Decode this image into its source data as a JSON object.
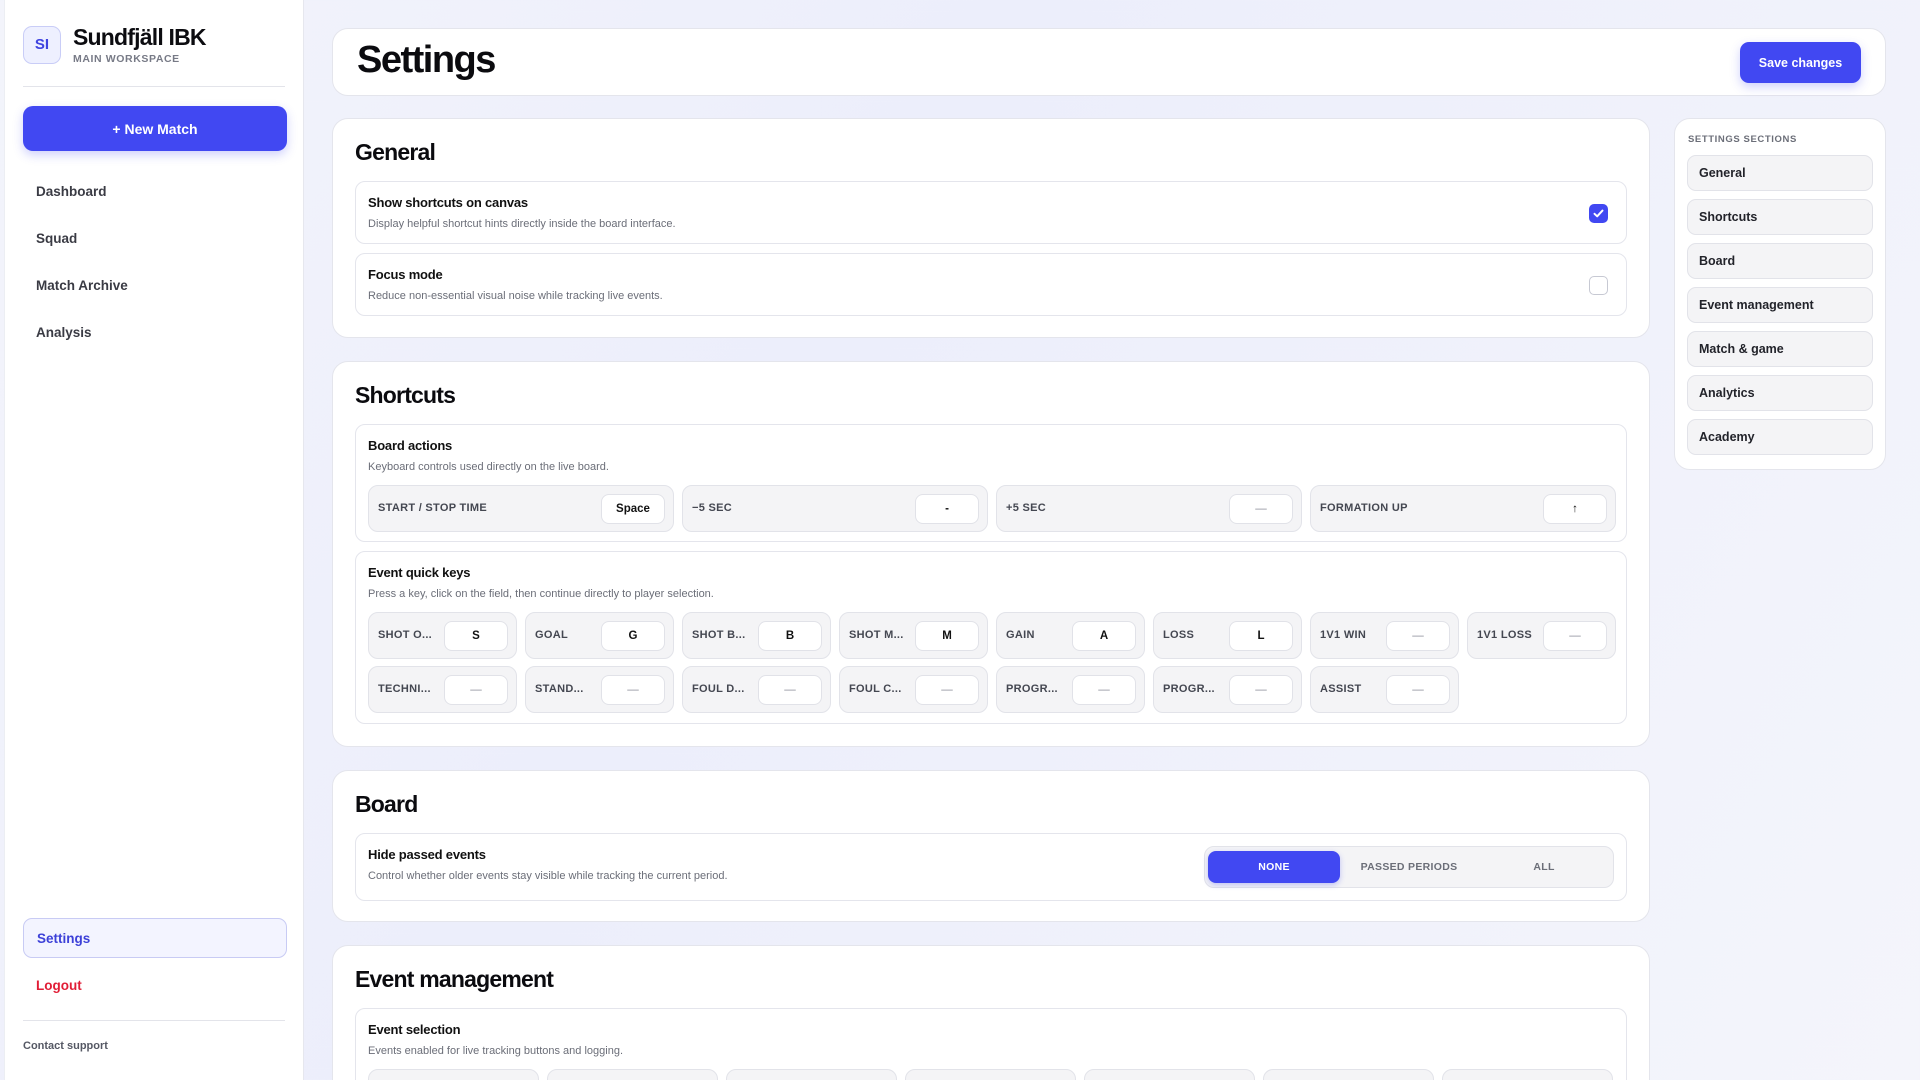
{
  "sidebar": {
    "badge": "SI",
    "club_name": "Sundfjäll IBK",
    "workspace": "MAIN WORKSPACE",
    "new_match": "+ New Match",
    "nav": [
      "Dashboard",
      "Squad",
      "Match Archive",
      "Analysis"
    ],
    "settings": "Settings",
    "logout": "Logout",
    "contact": "Contact support"
  },
  "header": {
    "title": "Settings",
    "save": "Save changes"
  },
  "general": {
    "title": "General",
    "items": [
      {
        "title": "Show shortcuts on canvas",
        "desc": "Display helpful shortcut hints directly inside the board interface.",
        "checked": true
      },
      {
        "title": "Focus mode",
        "desc": "Reduce non-essential visual noise while tracking live events.",
        "checked": false
      }
    ]
  },
  "shortcuts": {
    "title": "Shortcuts",
    "board_actions": {
      "title": "Board actions",
      "desc": "Keyboard controls used directly on the live board.",
      "keys": [
        {
          "label": "START / STOP TIME",
          "key": "Space"
        },
        {
          "label": "−5 SEC",
          "key": "-"
        },
        {
          "label": "+5 SEC",
          "key": "—"
        },
        {
          "label": "FORMATION UP",
          "key": "↑"
        }
      ]
    },
    "event_keys": {
      "title": "Event quick keys",
      "desc": "Press a key, click on the field, then continue directly to player selection.",
      "row1": [
        {
          "label": "SHOT O...",
          "key": "S"
        },
        {
          "label": "GOAL",
          "key": "G"
        },
        {
          "label": "SHOT B...",
          "key": "B"
        },
        {
          "label": "SHOT M...",
          "key": "M"
        },
        {
          "label": "GAIN",
          "key": "A"
        },
        {
          "label": "LOSS",
          "key": "L"
        },
        {
          "label": "1V1 WIN",
          "key": "—"
        },
        {
          "label": "1V1 LOSS",
          "key": "—"
        }
      ],
      "row2": [
        {
          "label": "TECHNI...",
          "key": "—"
        },
        {
          "label": "STAND...",
          "key": "—"
        },
        {
          "label": "FOUL D...",
          "key": "—"
        },
        {
          "label": "FOUL C...",
          "key": "—"
        },
        {
          "label": "PROGR...",
          "key": "—"
        },
        {
          "label": "PROGR...",
          "key": "—"
        },
        {
          "label": "ASSIST",
          "key": "—"
        }
      ]
    }
  },
  "board": {
    "title": "Board",
    "hide": {
      "title": "Hide passed events",
      "desc": "Control whether older events stay visible while tracking the current period.",
      "options": [
        "NONE",
        "PASSED PERIODS",
        "ALL"
      ],
      "selected": "NONE"
    }
  },
  "event_management": {
    "title": "Event management",
    "selection": {
      "title": "Event selection",
      "desc": "Events enabled for live tracking buttons and logging."
    }
  },
  "sections_nav": {
    "heading": "SETTINGS SECTIONS",
    "items": [
      "General",
      "Shortcuts",
      "Board",
      "Event management",
      "Match & game",
      "Analytics",
      "Academy"
    ]
  },
  "colors": {
    "accent": "#4148f2",
    "danger": "#e11d36"
  }
}
